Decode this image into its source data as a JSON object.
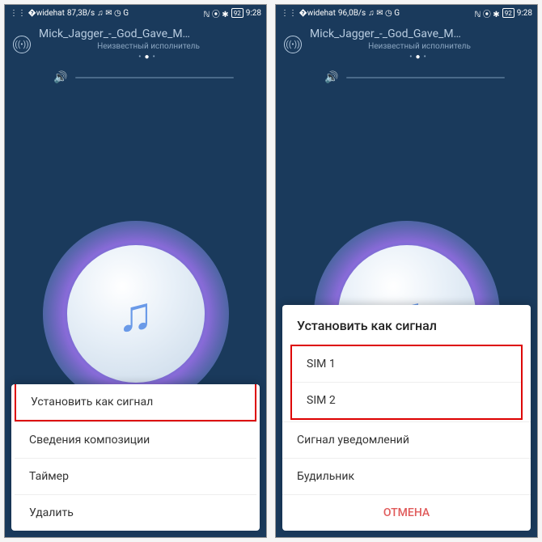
{
  "left": {
    "statusbar": {
      "signal": "87,3B/s",
      "net_icons": "♫ ✉ ◷ G",
      "right_icons": "ℕ ⦿ ✱",
      "battery": "92",
      "time": "9:28"
    },
    "header": {
      "track": "Mick_Jagger_-_God_Gave_M…",
      "artist": "Неизвестный исполнитель"
    },
    "popup": {
      "items": [
        "Установить как сигнал",
        "Сведения композиции",
        "Таймер",
        "Удалить"
      ]
    }
  },
  "right": {
    "statusbar": {
      "signal": "96,0B/s",
      "net_icons": "♫ ✉ ◷ G",
      "right_icons": "ℕ ⦿ ✱",
      "battery": "92",
      "time": "9:28"
    },
    "header": {
      "track": "Mick_Jagger_-_God_Gave_M…",
      "artist": "Неизвестный исполнитель"
    },
    "popup": {
      "title": "Установить как сигнал",
      "sim1": "SIM 1",
      "sim2": "SIM 2",
      "notif": "Сигнал уведомлений",
      "alarm": "Будильник",
      "cancel": "ОТМЕНА"
    }
  }
}
